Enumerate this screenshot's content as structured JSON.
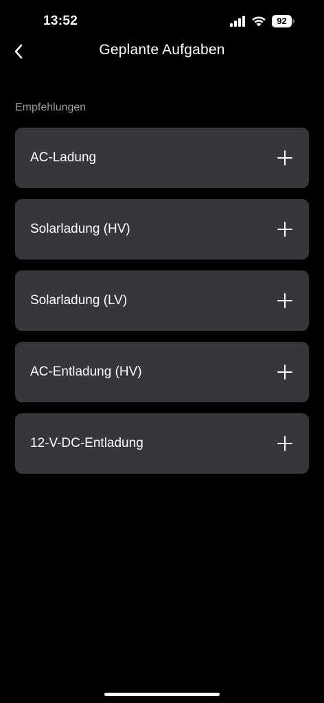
{
  "status_bar": {
    "time": "13:52",
    "battery_level": "92",
    "icons": [
      "signal-icon",
      "wifi-icon",
      "battery-icon"
    ]
  },
  "header": {
    "title": "Geplante Aufgaben",
    "back_icon": "chevron-left-icon"
  },
  "section": {
    "label": "Empfehlungen",
    "items": [
      {
        "label": "AC-Ladung",
        "icon": "plus-icon"
      },
      {
        "label": "Solarladung (HV)",
        "icon": "plus-icon"
      },
      {
        "label": "Solarladung (LV)",
        "icon": "plus-icon"
      },
      {
        "label": "AC-Entladung (HV)",
        "icon": "plus-icon"
      },
      {
        "label": "12-V-DC-Entladung",
        "icon": "plus-icon"
      }
    ]
  },
  "colors": {
    "background": "#000000",
    "card": "#37373b",
    "section_label": "#9a9a9e",
    "text": "#ffffff"
  }
}
